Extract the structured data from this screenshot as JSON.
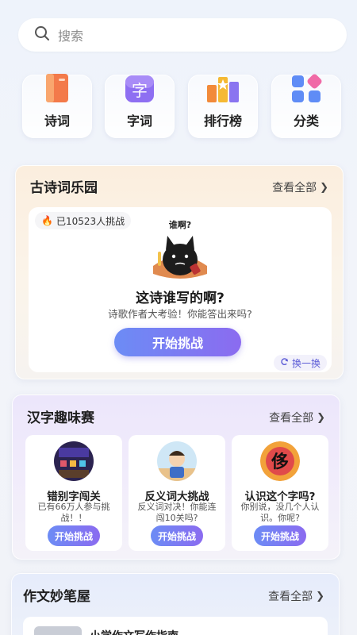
{
  "search": {
    "placeholder": "搜索"
  },
  "quick_entries": [
    {
      "label": "诗词",
      "icon": "book-icon"
    },
    {
      "label": "字词",
      "icon": "character-icon"
    },
    {
      "label": "排行榜",
      "icon": "leaderboard-icon"
    },
    {
      "label": "分类",
      "icon": "category-grid-icon"
    }
  ],
  "poem_section": {
    "title": "古诗词乐园",
    "more": "查看全部",
    "badge": "已10523人挑战",
    "mascot_caption": "谁啊?",
    "question": "这诗谁写的啊?",
    "subtitle": "诗歌作者大考验！你能答出来吗?",
    "start": "开始挑战",
    "swap": "换一换"
  },
  "hanzi_section": {
    "title": "汉字趣味赛",
    "more": "查看全部",
    "games": [
      {
        "title": "错别字闯关",
        "desc": "已有66万人参与挑战！！",
        "button": "开始挑战"
      },
      {
        "title": "反义词大挑战",
        "desc": "反义词对决！你能连闯10关吗?",
        "button": "开始挑战"
      },
      {
        "title": "认识这个字吗?",
        "desc": "你别说，没几个人认识。你呢?",
        "button": "开始挑战"
      }
    ],
    "thumb3_glyph": "侈"
  },
  "essay_section": {
    "title": "作文妙笔屋",
    "more": "查看全部",
    "first_item": "小学作文写作指南"
  },
  "colors": {
    "accent_start": "#6c8cf5",
    "accent_end": "#8b6bf0",
    "flame": "#f2552c"
  }
}
